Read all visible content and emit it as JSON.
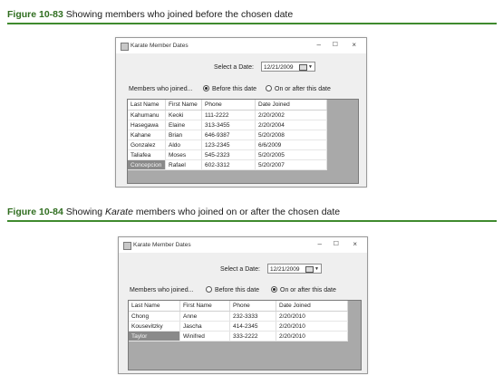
{
  "figure1": {
    "number": "Figure 10-83",
    "caption": "Showing members who joined before the chosen date",
    "window": {
      "title": "Karate Member Dates",
      "select_date_label": "Select a Date:",
      "date_value": "12/21/2009",
      "members_label": "Members who joined...",
      "radio_before": "Before this date",
      "radio_after": "On or after this date",
      "selected_radio": "before",
      "columns": [
        "Last Name",
        "First Name",
        "Phone",
        "Date Joined"
      ],
      "rows": [
        [
          "Kahumanu",
          "Keoki",
          "111-2222",
          "2/20/2002"
        ],
        [
          "Hasegawa",
          "Elaine",
          "313-3455",
          "2/20/2004"
        ],
        [
          "Kahane",
          "Brian",
          "646-9387",
          "5/20/2008"
        ],
        [
          "Gonzalez",
          "Aldo",
          "123-2345",
          "6/6/2009"
        ],
        [
          "Taliafea",
          "Moses",
          "545-2323",
          "5/20/2005"
        ],
        [
          "Concepcion",
          "Rafael",
          "602-3312",
          "5/20/2007"
        ]
      ]
    }
  },
  "figure2": {
    "number": "Figure 10-84",
    "caption_prefix": "Showing",
    "caption_italic": "Karate",
    "caption_suffix": "members who joined on or after the chosen date",
    "window": {
      "title": "Karate Member Dates",
      "select_date_label": "Select a Date:",
      "date_value": "12/21/2009",
      "members_label": "Members who joined...",
      "radio_before": "Before this date",
      "radio_after": "On or after this date",
      "selected_radio": "after",
      "columns": [
        "Last Name",
        "First Name",
        "Phone",
        "Date Joined"
      ],
      "rows": [
        [
          "Chong",
          "Anne",
          "232-3333",
          "2/20/2010"
        ],
        [
          "Kousevitzky",
          "Jascha",
          "414-2345",
          "2/20/2010"
        ],
        [
          "Taylor",
          "Winifred",
          "333-2222",
          "2/20/2010"
        ]
      ]
    }
  },
  "window_controls": {
    "minimize": "–",
    "maximize": "☐",
    "close": "×"
  },
  "colors": {
    "caption_rule": "#3f8a2e",
    "figure_number": "#2f6d1f",
    "selected_cell": "#8a8a8a"
  }
}
